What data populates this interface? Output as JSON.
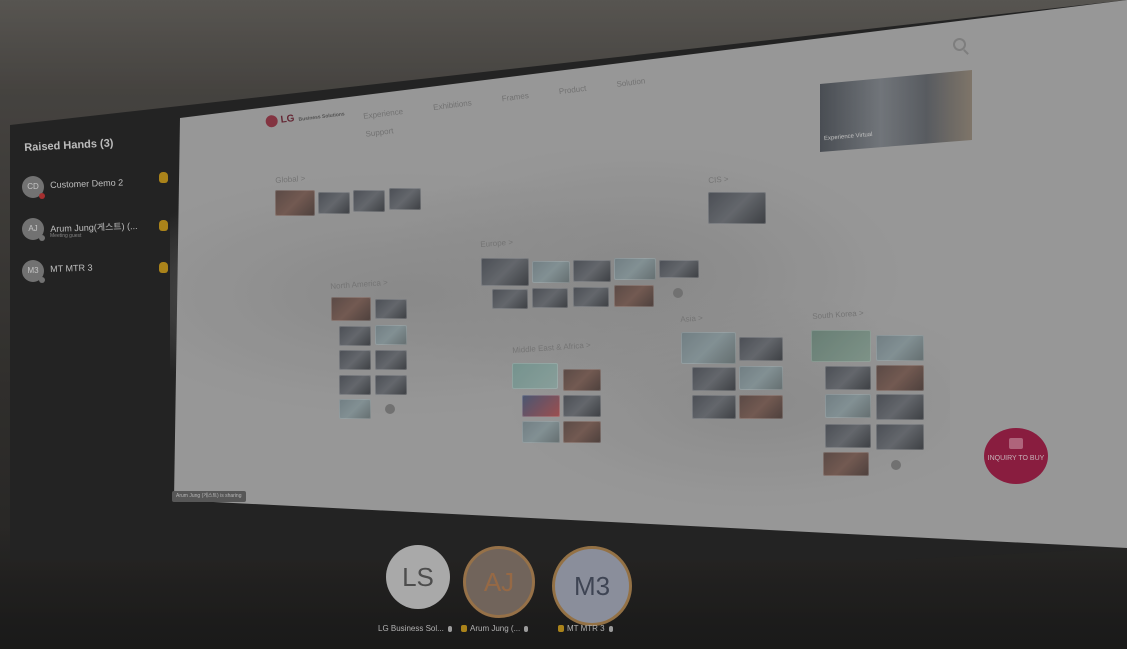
{
  "sidebar": {
    "title": "Raised Hands (3)",
    "participants": [
      {
        "initials": "CD",
        "name": "Customer Demo 2",
        "sub": ""
      },
      {
        "initials": "AJ",
        "name": "Arum Jung(게스트) (...",
        "sub": "Meeting guest"
      },
      {
        "initials": "M3",
        "name": "MT MTR 3",
        "sub": ""
      }
    ]
  },
  "site": {
    "logo": "LG",
    "logo_tag": "Business Solutions",
    "nav": [
      "Experience",
      "Exhibitions",
      "Frames",
      "Product",
      "Solution",
      "Support"
    ],
    "hero_label": "Experience Virtual",
    "regions": {
      "global": "Global >",
      "cis": "CIS >",
      "europe": "Europe >",
      "north_america": "North America >",
      "middle_east": "Middle East & Africa >",
      "asia": "Asia >",
      "south_korea": "South Korea >"
    },
    "inquiry": "INQUIRY TO BUY"
  },
  "share_tag": "Arum Jung (게스트) is sharing",
  "participants_bar": [
    {
      "initials": "LS",
      "label": "LG Business Sol..."
    },
    {
      "initials": "AJ",
      "label": "Arum Jung (..."
    },
    {
      "initials": "M3",
      "label": "MT MTR 3"
    }
  ],
  "icons": {
    "search": "search-icon",
    "hand": "raised-hand-icon",
    "mic": "mic-icon",
    "chat": "chat-icon"
  }
}
